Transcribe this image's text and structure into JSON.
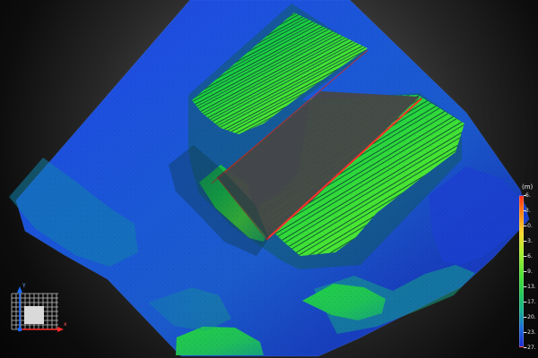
{
  "viewer": {
    "scale": {
      "unit": "(m)",
      "labels": [
        "6.",
        "3.",
        "-0.",
        "-3.",
        "-6.",
        "-9.",
        "-13.",
        "-17.",
        "-20.",
        "-23.",
        "-27."
      ]
    },
    "axis_widget": {
      "x_label": "x",
      "y_label": "Y"
    }
  }
}
